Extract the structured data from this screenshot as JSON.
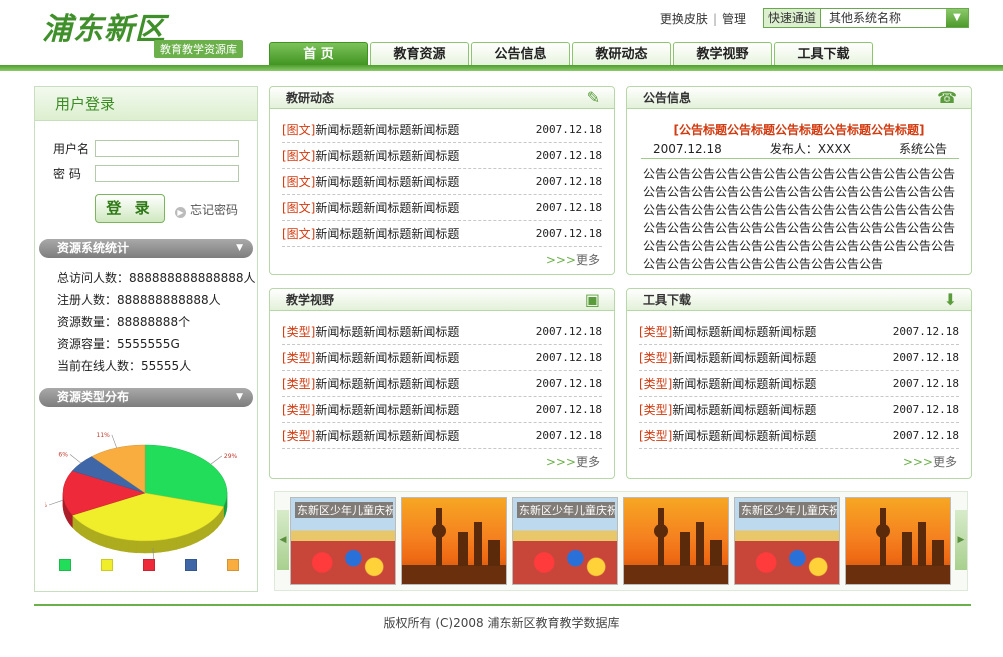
{
  "header": {
    "logo_main": "浦东新区",
    "logo_sub": "教育教学资源库",
    "links": [
      "更换皮肤",
      "管理"
    ],
    "quick_label": "快速通道",
    "quick_value": "其他系统名称"
  },
  "nav": [
    "首 页",
    "教育资源",
    "公告信息",
    "教研动态",
    "教学视野",
    "工具下载"
  ],
  "login": {
    "title": "用户登录",
    "username_label": "用户名",
    "password_label": "密 码",
    "button": "登 录",
    "forgot": "忘记密码"
  },
  "stats": {
    "title": "资源系统统计",
    "items": [
      "总访问人数：888888888888888人",
      "注册人数：888888888888人",
      "资源数量：88888888个",
      "资源容量：5555555G",
      "当前在线人数：55555人"
    ]
  },
  "distribution": {
    "title": "资源类型分布"
  },
  "chart_data": {
    "type": "pie",
    "values": [
      29,
      37,
      15,
      6,
      11
    ],
    "labels": [
      "29%",
      "37%",
      "15%",
      "6%",
      "11%"
    ],
    "colors": [
      "#22dd5a",
      "#f0ee2a",
      "#ee2a3a",
      "#3f67a8",
      "#f9ad3f"
    ]
  },
  "research": {
    "title": "教研动态",
    "items": [
      {
        "tag": "[图文]",
        "text": "新闻标题新闻标题新闻标题",
        "date": "2007.12.18"
      },
      {
        "tag": "[图文]",
        "text": "新闻标题新闻标题新闻标题",
        "date": "2007.12.18"
      },
      {
        "tag": "[图文]",
        "text": "新闻标题新闻标题新闻标题",
        "date": "2007.12.18"
      },
      {
        "tag": "[图文]",
        "text": "新闻标题新闻标题新闻标题",
        "date": "2007.12.18"
      },
      {
        "tag": "[图文]",
        "text": "新闻标题新闻标题新闻标题",
        "date": "2007.12.18"
      }
    ],
    "more": "更多"
  },
  "notice": {
    "title": "公告信息",
    "headline": "[公告标题公告标题公告标题公告标题公告标题]",
    "date": "2007.12.18",
    "publisher": "发布人：XXXX",
    "source": "系统公告",
    "body": "公告公告公告公告公告公告公告公告公告公告公告公告公告公告公告公告公告公告公告公告公告公告公告公告公告公告公告公告公告公告公告公告公告公告公告公告公告公告公告公告公告公告公告公告公告公告公告公告公告公告公告公告公告公告公告公告公告公告公告公告公告公告公告公告公告公告公告公告公告公告公告公告公告公告公告"
  },
  "vision": {
    "title": "教学视野",
    "items": [
      {
        "tag": "[类型]",
        "text": "新闻标题新闻标题新闻标题",
        "date": "2007.12.18"
      },
      {
        "tag": "[类型]",
        "text": "新闻标题新闻标题新闻标题",
        "date": "2007.12.18"
      },
      {
        "tag": "[类型]",
        "text": "新闻标题新闻标题新闻标题",
        "date": "2007.12.18"
      },
      {
        "tag": "[类型]",
        "text": "新闻标题新闻标题新闻标题",
        "date": "2007.12.18"
      },
      {
        "tag": "[类型]",
        "text": "新闻标题新闻标题新闻标题",
        "date": "2007.12.18"
      }
    ],
    "more": "更多"
  },
  "tools": {
    "title": "工具下载",
    "items": [
      {
        "tag": "[类型]",
        "text": "新闻标题新闻标题新闻标题",
        "date": "2007.12.18"
      },
      {
        "tag": "[类型]",
        "text": "新闻标题新闻标题新闻标题",
        "date": "2007.12.18"
      },
      {
        "tag": "[类型]",
        "text": "新闻标题新闻标题新闻标题",
        "date": "2007.12.18"
      },
      {
        "tag": "[类型]",
        "text": "新闻标题新闻标题新闻标题",
        "date": "2007.12.18"
      },
      {
        "tag": "[类型]",
        "text": "新闻标题新闻标题新闻标题",
        "date": "2007.12.18"
      }
    ],
    "more": "更多"
  },
  "gallery": {
    "caption": "东新区少年儿童庆祝“六一”"
  },
  "footer": "版权所有 (C)2008  浦东新区教育教学数据库"
}
